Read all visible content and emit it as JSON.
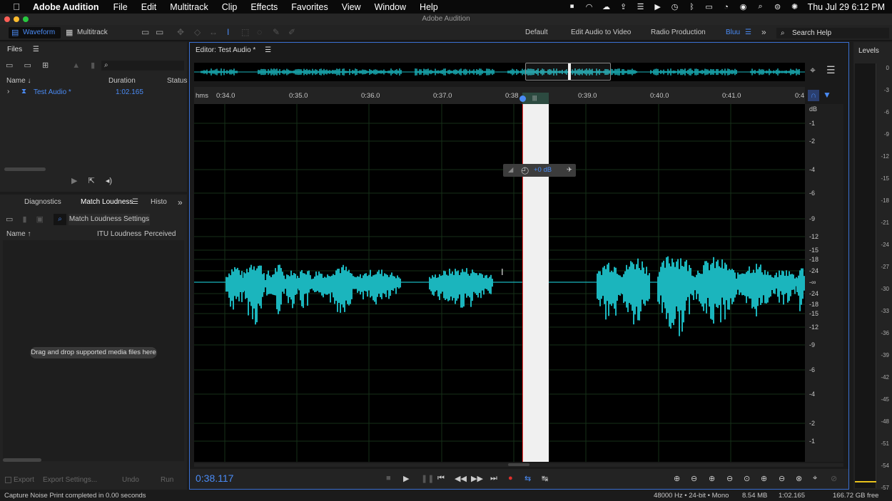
{
  "menubar": {
    "apple": "",
    "app_name": "Adobe Audition",
    "menus": [
      "File",
      "Edit",
      "Multitrack",
      "Clip",
      "Effects",
      "Favorites",
      "View",
      "Window",
      "Help"
    ],
    "clock": "Thu Jul 29  6:12 PM"
  },
  "window": {
    "title": "Adobe Audition"
  },
  "toolbar": {
    "waveform_label": "Waveform",
    "multitrack_label": "Multitrack",
    "workspaces": [
      "Default",
      "Edit Audio to Video",
      "Radio Production",
      "Bluu"
    ],
    "search_placeholder": "Search Help"
  },
  "files_panel": {
    "title": "Files",
    "columns": {
      "name": "Name ↓",
      "duration": "Duration",
      "status": "Status"
    },
    "rows": [
      {
        "name": "Test Audio *",
        "duration": "1:02.165"
      }
    ]
  },
  "loudness_panel": {
    "tabs": [
      "Diagnostics",
      "Match Loudness",
      "Histo"
    ],
    "settings_label": "Match Loudness Settings",
    "columns": {
      "name": "Name ↑",
      "itu": "ITU Loudness",
      "perceived": "Perceived"
    },
    "drop_hint": "Drag and drop supported media files here",
    "footer": {
      "export": "Export",
      "export_settings": "Export Settings...",
      "undo": "Undo",
      "run": "Run"
    }
  },
  "editor": {
    "title": "Editor: Test Audio *",
    "ruler_unit": "hms",
    "ruler_ticks": [
      "0:34.0",
      "0:35.0",
      "0:36.0",
      "0:37.0",
      "0:38",
      "0:39.0",
      "0:40.0",
      "0:41.0",
      "0:4"
    ],
    "db_unit": "dB",
    "db_labels": [
      "-1",
      "-2",
      "-4",
      "-6",
      "-9",
      "-12",
      "-15",
      "-18",
      "-24",
      "-∞",
      "-24",
      "-18",
      "-15",
      "-12",
      "-9",
      "-6",
      "-4",
      "-2",
      "-1"
    ],
    "hud_gain": "+0 dB",
    "timecode": "0:38.117"
  },
  "levels_panel": {
    "title": "Levels",
    "scale": [
      "0",
      "-3",
      "-6",
      "-9",
      "-12",
      "-15",
      "-18",
      "-21",
      "-24",
      "-27",
      "-30",
      "-33",
      "-36",
      "-39",
      "-42",
      "-45",
      "-48",
      "-51",
      "-54",
      "-57"
    ]
  },
  "status_bar": {
    "message": "Capture Noise Print completed in 0.00 seconds",
    "format": "48000 Hz • 24-bit • Mono",
    "size": "8.54 MB",
    "duration": "1:02.165",
    "free": "166.72 GB free"
  },
  "colors": {
    "accent": "#4a8bf5",
    "waveform": "#1bb5bd",
    "record": "#e0302c"
  }
}
